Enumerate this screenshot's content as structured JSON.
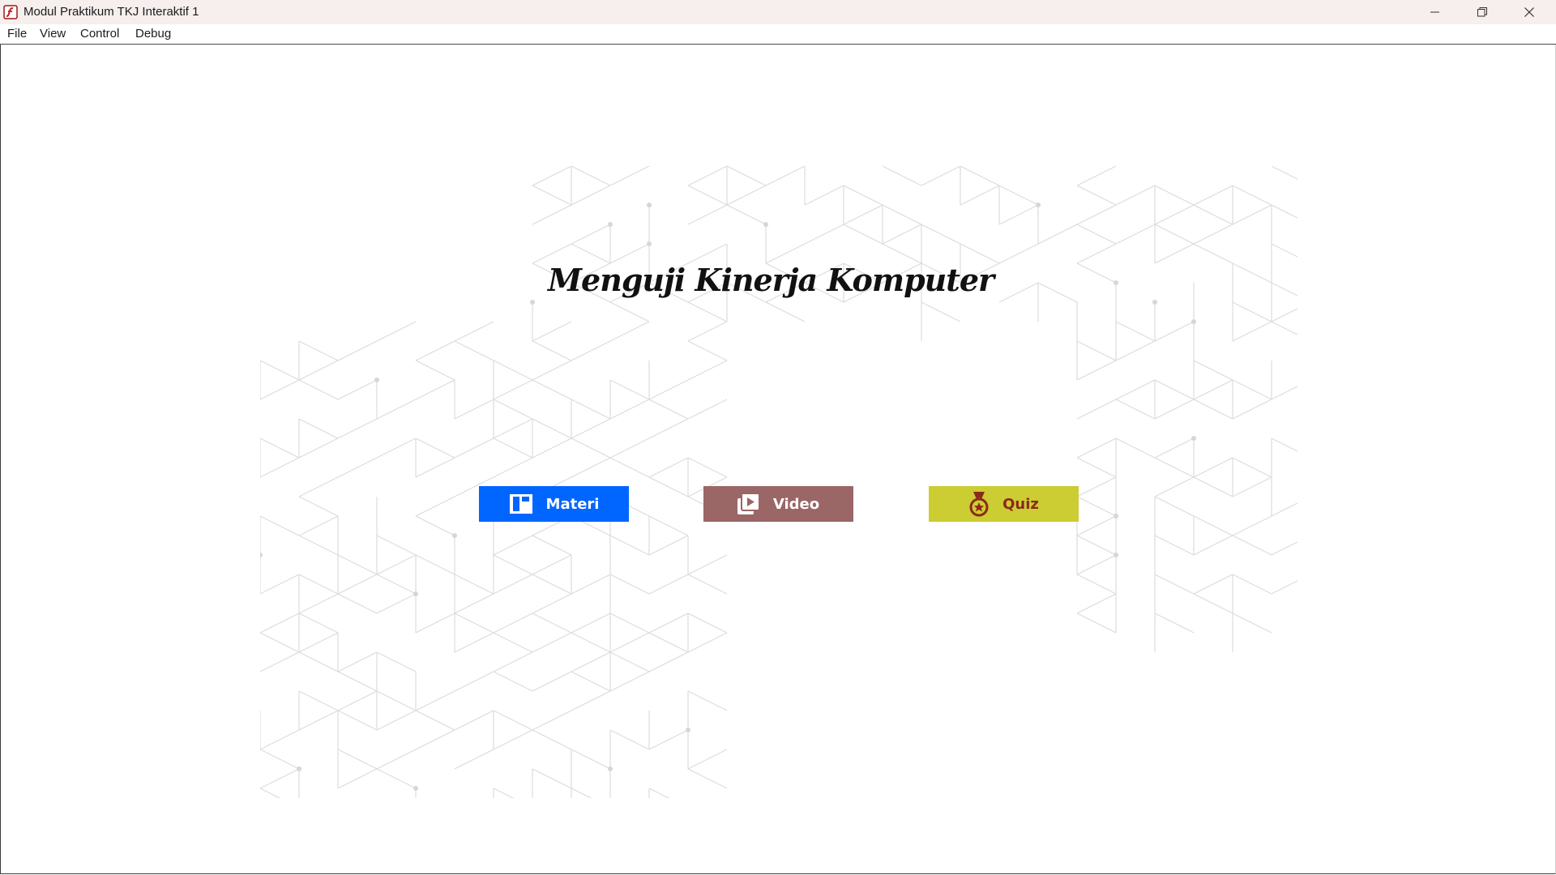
{
  "window": {
    "title": "Modul Praktikum TKJ Interaktif 1"
  },
  "menubar": {
    "items": [
      {
        "label": "File"
      },
      {
        "label": "View"
      },
      {
        "label": "Control"
      },
      {
        "label": "Debug"
      }
    ]
  },
  "stage": {
    "title": "Menguji Kinerja Komputer",
    "buttons": [
      {
        "label": "Materi",
        "icon": "book-icon",
        "color": "#0066ff"
      },
      {
        "label": "Video",
        "icon": "video-play-icon",
        "color": "#9b6666"
      },
      {
        "label": "Quiz",
        "icon": "medal-icon",
        "color": "#cccc33"
      }
    ]
  }
}
